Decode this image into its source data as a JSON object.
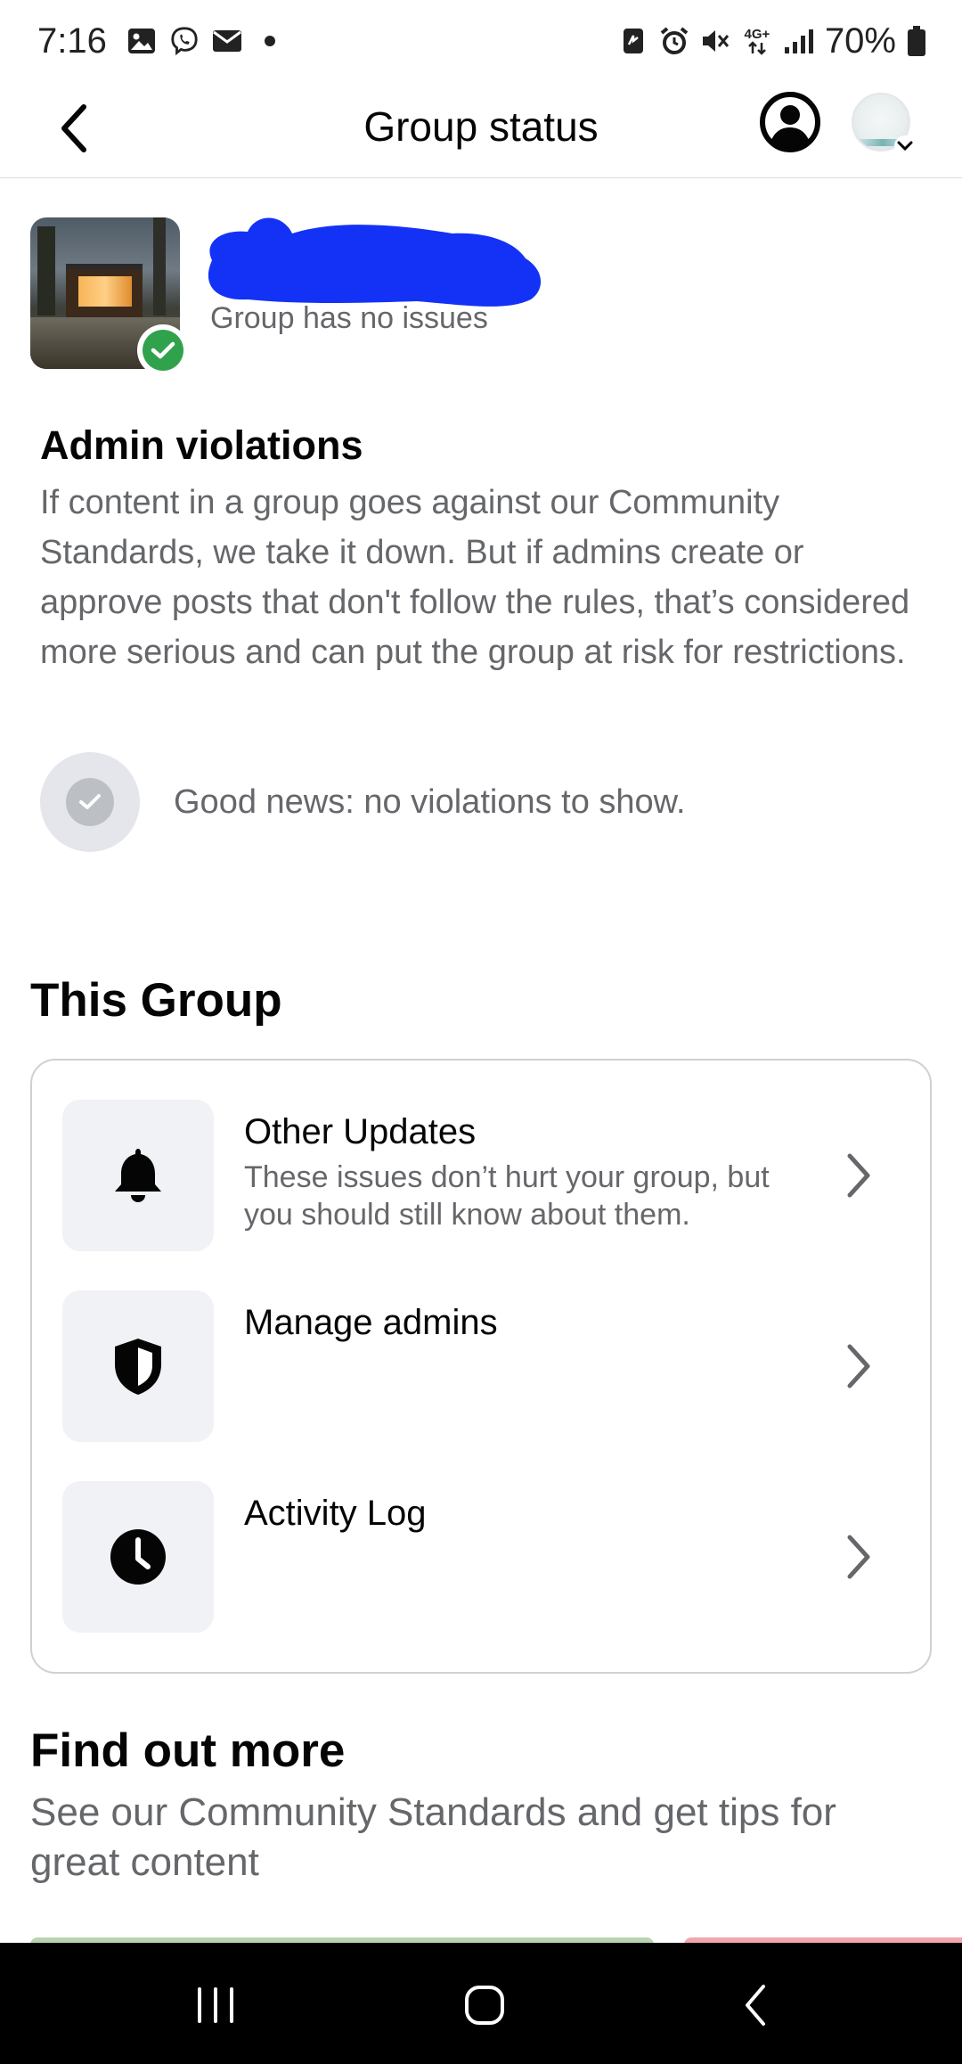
{
  "status_bar": {
    "time": "7:16",
    "network": "4G+",
    "battery": "70%",
    "left_icons": [
      "image-icon",
      "viber-icon",
      "mail-icon",
      "dot-icon"
    ],
    "right_icons": [
      "nfc-icon",
      "alarm-icon",
      "mute-icon",
      "network-icon",
      "signal-icon",
      "battery-icon"
    ]
  },
  "header": {
    "title": "Group status"
  },
  "group": {
    "status": "Group has no issues",
    "status_color": "#31a24c"
  },
  "admin_violations": {
    "title": "Admin violations",
    "description": "If content in a group goes against our Community Standards, we take it down. But if admins create or approve posts that don't follow the rules, that’s considered more serious and can put the group at risk for restrictions.",
    "empty_message": "Good news: no violations to show."
  },
  "this_group": {
    "title": "This Group",
    "items": [
      {
        "icon": "bell-icon",
        "title": "Other Updates",
        "subtitle": "These issues don’t hurt your group, but you should still know about them."
      },
      {
        "icon": "shield-icon",
        "title": "Manage admins",
        "subtitle": ""
      },
      {
        "icon": "clock-icon",
        "title": "Activity Log",
        "subtitle": ""
      }
    ]
  },
  "find_out_more": {
    "title": "Find out more",
    "description": "See our Community Standards and get tips for great content"
  },
  "colors": {
    "accent_redaction": "#1432f5",
    "secondary_text": "#65676b",
    "navbar": "#000000"
  }
}
